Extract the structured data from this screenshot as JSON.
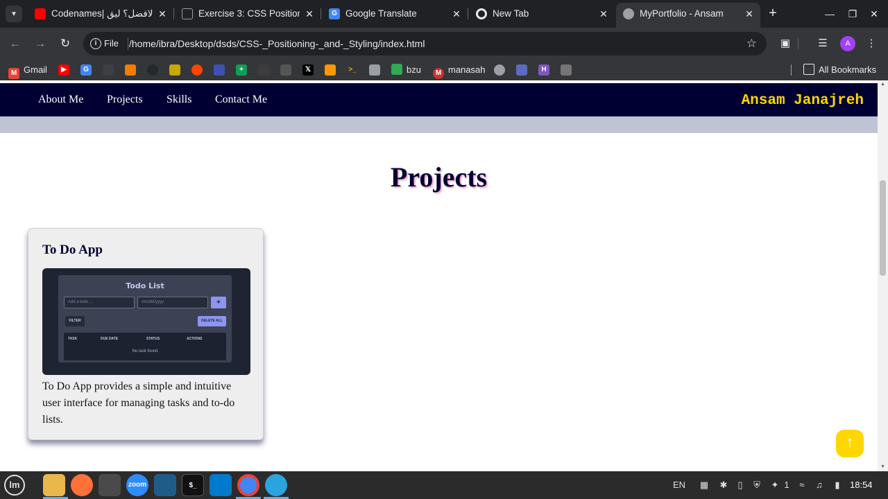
{
  "browser": {
    "tabs": [
      {
        "title": "Codenames| الافضل؟ ليق",
        "favicon": "youtube-icon",
        "color": "#ff0000"
      },
      {
        "title": "Exercise 3: CSS Positioni",
        "favicon": "classroom-icon",
        "color": "#9aa0a6"
      },
      {
        "title": "Google Translate",
        "favicon": "translate-icon",
        "color": "#4285f4"
      },
      {
        "title": "New Tab",
        "favicon": "chrome-icon",
        "color": "#e8eaed"
      },
      {
        "title": "MyPortfolio - Ansam",
        "favicon": "globe-icon",
        "color": "#9aa0a6"
      }
    ],
    "address": {
      "scheme_label": "File",
      "url": "/home/ibra/Desktop/dsds/CSS-_Positioning-_and-_Styling/index.html"
    },
    "profile_initial": "A",
    "bookmarks": [
      {
        "label": "Gmail",
        "icon": "gmail-icon",
        "color": "#ea4335"
      },
      {
        "label": "",
        "icon": "youtube-icon",
        "color": "#ff0000"
      },
      {
        "label": "",
        "icon": "translate-icon",
        "color": "#4285f4"
      },
      {
        "label": "",
        "icon": "github-icon",
        "color": "#3c4043"
      },
      {
        "label": "",
        "icon": "coin-icon",
        "color": "#f57c00"
      },
      {
        "label": "",
        "icon": "github-cat-icon",
        "color": "#24292e"
      },
      {
        "label": "",
        "icon": "emoji-icon",
        "color": "#c9a800"
      },
      {
        "label": "",
        "icon": "reddit-icon",
        "color": "#ff4500"
      },
      {
        "label": "",
        "icon": "calendar-icon",
        "color": "#3f51b5"
      },
      {
        "label": "",
        "icon": "sheets-icon",
        "color": "#0f9d58"
      },
      {
        "label": "",
        "icon": "cc-icon",
        "color": "#3c3c3c"
      },
      {
        "label": "",
        "icon": "dictionary-icon",
        "color": "#555555"
      },
      {
        "label": "",
        "icon": "x-icon",
        "color": "#000000"
      },
      {
        "label": "",
        "icon": "bar-chart-icon",
        "color": "#ff9800"
      },
      {
        "label": "",
        "icon": "terminal-icon",
        "color": "#f9ab00"
      },
      {
        "label": "",
        "icon": "document-icon",
        "color": "#9aa0a6"
      },
      {
        "label": "bzu",
        "icon": "drive-icon",
        "color": "#34a853"
      },
      {
        "label": "manasah",
        "icon": "manasah-icon",
        "color": "#d32f2f"
      },
      {
        "label": "",
        "icon": "globe-icon",
        "color": "#9aa0a6"
      },
      {
        "label": "",
        "icon": "cube-icon",
        "color": "#5c6bc0"
      },
      {
        "label": "",
        "icon": "h-icon",
        "color": "#7e57c2"
      },
      {
        "label": "",
        "icon": "list-icon",
        "color": "#757575"
      }
    ],
    "all_bookmarks_label": "All Bookmarks"
  },
  "page": {
    "nav": {
      "links": [
        "About Me",
        "Projects",
        "Skills",
        "Contact Me"
      ],
      "brand": "Ansam Janajreh",
      "brand_color": "#ffd700",
      "background": "#000033"
    },
    "section_title": "Projects",
    "project": {
      "title": "To Do App",
      "screenshot": {
        "heading": "Todo List",
        "todo_placeholder": "Add a todo ...",
        "date_placeholder": "mm/dd/yyyy",
        "add_label": "+",
        "filter_label": "FILTER",
        "delete_all_label": "DELETE ALL",
        "columns": [
          "TASK",
          "DUE DATE",
          "STATUS",
          "ACTIONS"
        ],
        "empty_text": "No task found"
      },
      "description": "To Do App provides a simple and intuitive user interface for managing tasks and to-do lists."
    },
    "scroll_top_icon": "up-arrow-icon",
    "scroll_top_color": "#ffd700"
  },
  "taskbar": {
    "apps": [
      {
        "icon": "files-icon",
        "label": "",
        "color": "#e8b84a"
      },
      {
        "icon": "firefox-icon",
        "label": "",
        "color": "#ff7139"
      },
      {
        "icon": "screenshot-icon",
        "label": "",
        "color": "#4a4a4a"
      },
      {
        "icon": "zoom-icon",
        "label": "zoom",
        "color": "#2d8cff"
      },
      {
        "icon": "mysql-workbench-icon",
        "label": "",
        "color": "#1f5c8a"
      },
      {
        "icon": "terminal-icon",
        "label": "",
        "color": "#111111"
      },
      {
        "icon": "vscode-icon",
        "label": "",
        "color": "#007acc"
      },
      {
        "icon": "chrome-icon",
        "label": "",
        "color": "#4285f4"
      },
      {
        "icon": "telegram-icon",
        "label": "",
        "color": "#2aa3df"
      }
    ],
    "language": "EN",
    "notification_count": "1",
    "clock": "18:54"
  }
}
